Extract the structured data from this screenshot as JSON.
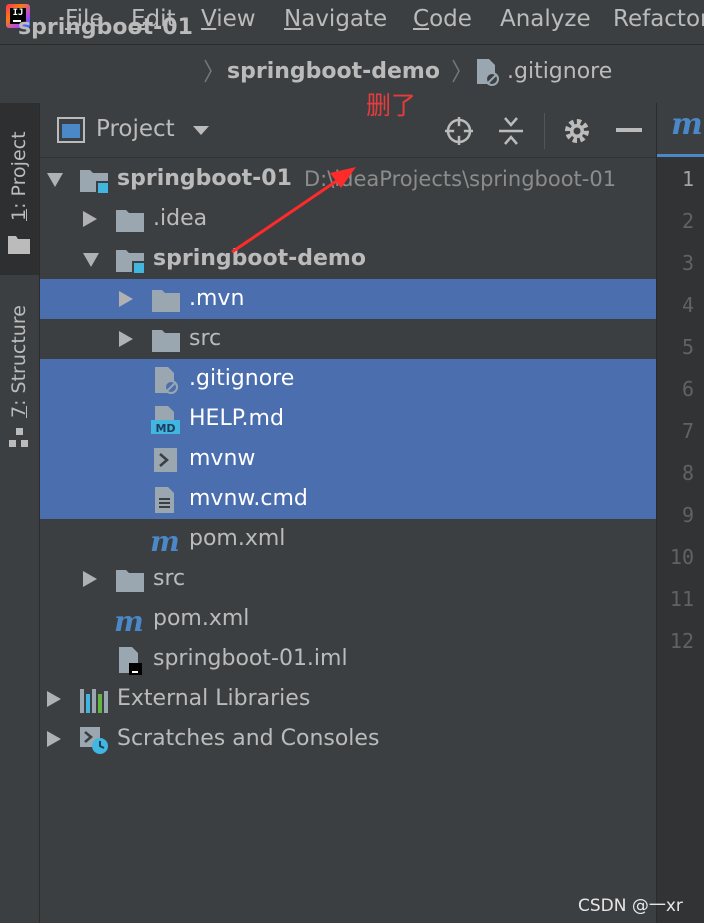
{
  "menu": {
    "items": [
      {
        "mnemonic": "F",
        "rest": "ile"
      },
      {
        "mnemonic": "E",
        "rest": "dit"
      },
      {
        "mnemonic": "V",
        "rest": "iew"
      },
      {
        "mnemonic": "N",
        "rest": "avigate"
      },
      {
        "mnemonic": "C",
        "rest": "ode"
      },
      {
        "mnemonic": "",
        "rest": "Analyze"
      },
      {
        "mnemonic": "",
        "rest": "Refactor"
      }
    ]
  },
  "breadcrumb": {
    "items": [
      "springboot-01",
      "springboot-demo",
      ".gitignore"
    ]
  },
  "tool_strip": {
    "project_tab": {
      "mnemonic": "1",
      "rest": ": Project"
    },
    "structure_tab": {
      "mnemonic": "7",
      "rest": ": Structure"
    }
  },
  "panel": {
    "title": "Project",
    "icons": [
      "locate-icon",
      "collapse-all-icon",
      "gear-icon",
      "hide-icon"
    ]
  },
  "tree": [
    {
      "name": "springboot-01",
      "path": "D:\\ideaProjects\\springboot-01",
      "icon": "module-folder-icon",
      "depth": 0,
      "toggle": "expanded",
      "bold": true,
      "selected": false
    },
    {
      "name": ".idea",
      "icon": "folder-icon",
      "depth": 1,
      "toggle": "collapsed",
      "bold": false,
      "selected": false
    },
    {
      "name": "springboot-demo",
      "icon": "module-folder-icon",
      "depth": 1,
      "toggle": "expanded",
      "bold": true,
      "selected": false
    },
    {
      "name": ".mvn",
      "icon": "folder-icon",
      "depth": 2,
      "toggle": "collapsed",
      "bold": false,
      "selected": true
    },
    {
      "name": "src",
      "icon": "folder-icon",
      "depth": 2,
      "toggle": "collapsed",
      "bold": false,
      "selected": false
    },
    {
      "name": ".gitignore",
      "icon": "ignored-file-icon",
      "depth": 2,
      "toggle": "none",
      "bold": false,
      "selected": true
    },
    {
      "name": "HELP.md",
      "icon": "markdown-file-icon",
      "depth": 2,
      "toggle": "none",
      "bold": false,
      "selected": true
    },
    {
      "name": "mvnw",
      "icon": "shell-script-icon",
      "depth": 2,
      "toggle": "none",
      "bold": false,
      "selected": true
    },
    {
      "name": "mvnw.cmd",
      "icon": "text-file-icon",
      "depth": 2,
      "toggle": "none",
      "bold": false,
      "selected": true
    },
    {
      "name": "pom.xml",
      "icon": "maven-icon",
      "depth": 2,
      "toggle": "none",
      "bold": false,
      "selected": false
    },
    {
      "name": "src",
      "icon": "folder-icon",
      "depth": 1,
      "toggle": "collapsed",
      "bold": false,
      "selected": false
    },
    {
      "name": "pom.xml",
      "icon": "maven-icon",
      "depth": 1,
      "toggle": "none",
      "bold": false,
      "selected": false
    },
    {
      "name": "springboot-01.iml",
      "icon": "iml-file-icon",
      "depth": 1,
      "toggle": "none",
      "bold": false,
      "selected": false
    },
    {
      "name": "External Libraries",
      "icon": "libraries-icon",
      "depth": 0,
      "toggle": "collapsed",
      "bold": false,
      "selected": false
    },
    {
      "name": "Scratches and Consoles",
      "icon": "scratches-icon",
      "depth": 0,
      "toggle": "collapsed",
      "bold": false,
      "selected": false
    }
  ],
  "editor": {
    "tab_glyph": "m",
    "line_numbers": [
      "1",
      "2",
      "3",
      "4",
      "5",
      "6",
      "7",
      "8",
      "9",
      "10",
      "11",
      "12"
    ]
  },
  "annotation": {
    "text": "删了",
    "color": "#e83b3b"
  },
  "watermark": "CSDN @一xr",
  "colors": {
    "selection": "#4b6eaf",
    "background": "#3c3f41",
    "folder": "#9aa7b0",
    "accent": "#40b6e0"
  }
}
